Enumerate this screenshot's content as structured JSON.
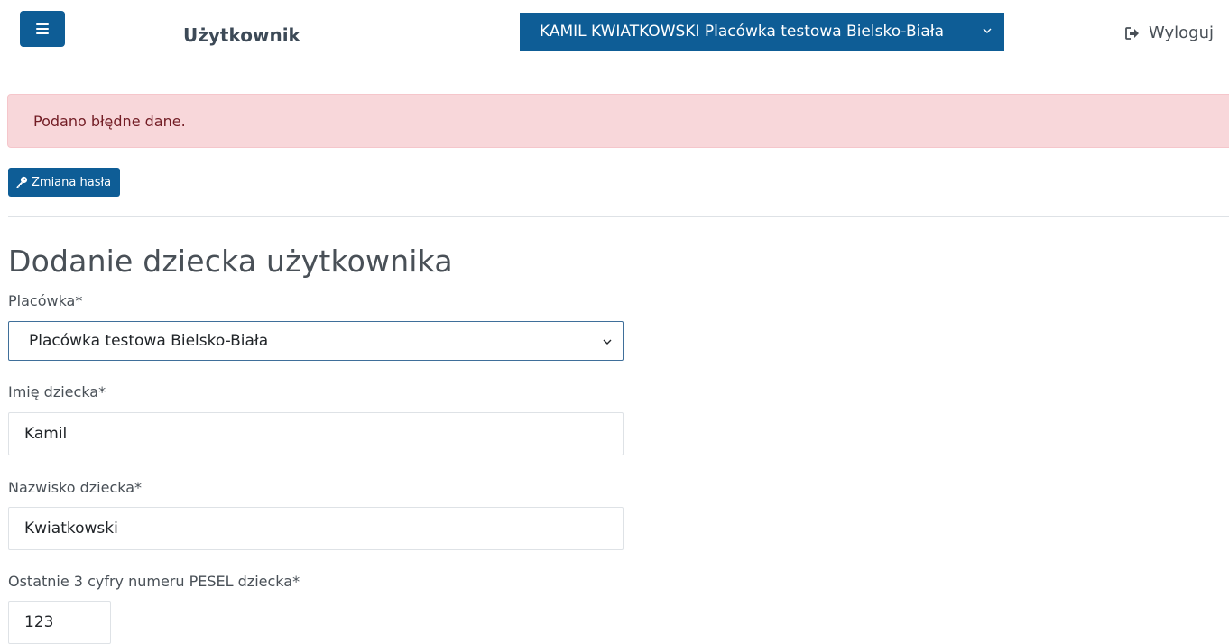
{
  "header": {
    "menu_icon": "hamburger-icon",
    "title": "Użytkownik",
    "user_selector": "KAMIL KWIATKOWSKI Placówka testowa Bielsko-Biała",
    "logout_icon": "sign-out-icon",
    "logout_label": "Wyloguj"
  },
  "alert": {
    "message": "Podano błędne dane."
  },
  "toolbar": {
    "change_password_icon": "key-icon",
    "change_password_label": "Zmiana hasła"
  },
  "form": {
    "title": "Dodanie dziecka użytkownika",
    "facility_label": "Placówka*",
    "facility_value": "Placówka testowa Bielsko-Biała",
    "first_name_label": "Imię dziecka*",
    "first_name_value": "Kamil",
    "last_name_label": "Nazwisko dziecka*",
    "last_name_value": "Kwiatkowski",
    "pesel_label": "Ostatnie 3 cyfry numeru PESEL dziecka*",
    "pesel_value": "123"
  },
  "colors": {
    "primary": "#0e5d96",
    "alert_bg": "#f8d7da",
    "alert_text": "#721c24"
  }
}
